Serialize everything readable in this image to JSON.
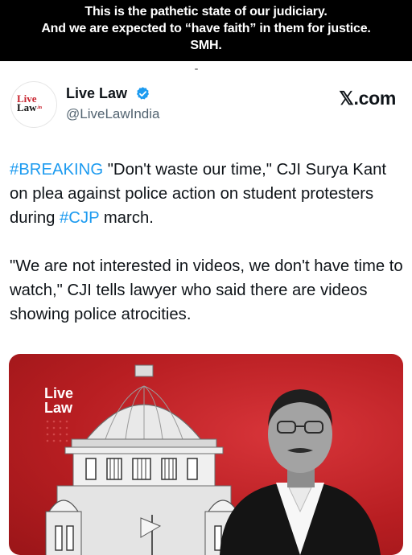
{
  "caption": {
    "line1": "This is the pathetic state of our judiciary.",
    "line2": "And we are expected to “have faith” in them for justice.",
    "line3": "SMH."
  },
  "account": {
    "avatar_line1": "Live",
    "avatar_line2": "Law",
    "avatar_suffix": ".in",
    "name": "Live Law",
    "handle": "@LiveLawIndia",
    "verified_icon": "verified-badge-icon"
  },
  "site": {
    "label": "𝕏.com"
  },
  "tweet": {
    "p1_hashtag": "#BREAKING",
    "p1_text_a": " \"Don't waste our time,\" CJI Surya Kant on plea against police action on student protesters during ",
    "p1_hashtag2": "#CJP",
    "p1_text_b": " march.",
    "p2": "\"We are not interested in videos, we don't have time to watch,\" CJI tells lawyer who said there are videos showing police atrocities."
  },
  "media": {
    "logo_line1": "Live",
    "logo_line2": "Law",
    "background_color": "#c0242a"
  },
  "colors": {
    "link": "#1d9bf0",
    "verified": "#1d9bf0",
    "caption_bg": "#000000"
  }
}
